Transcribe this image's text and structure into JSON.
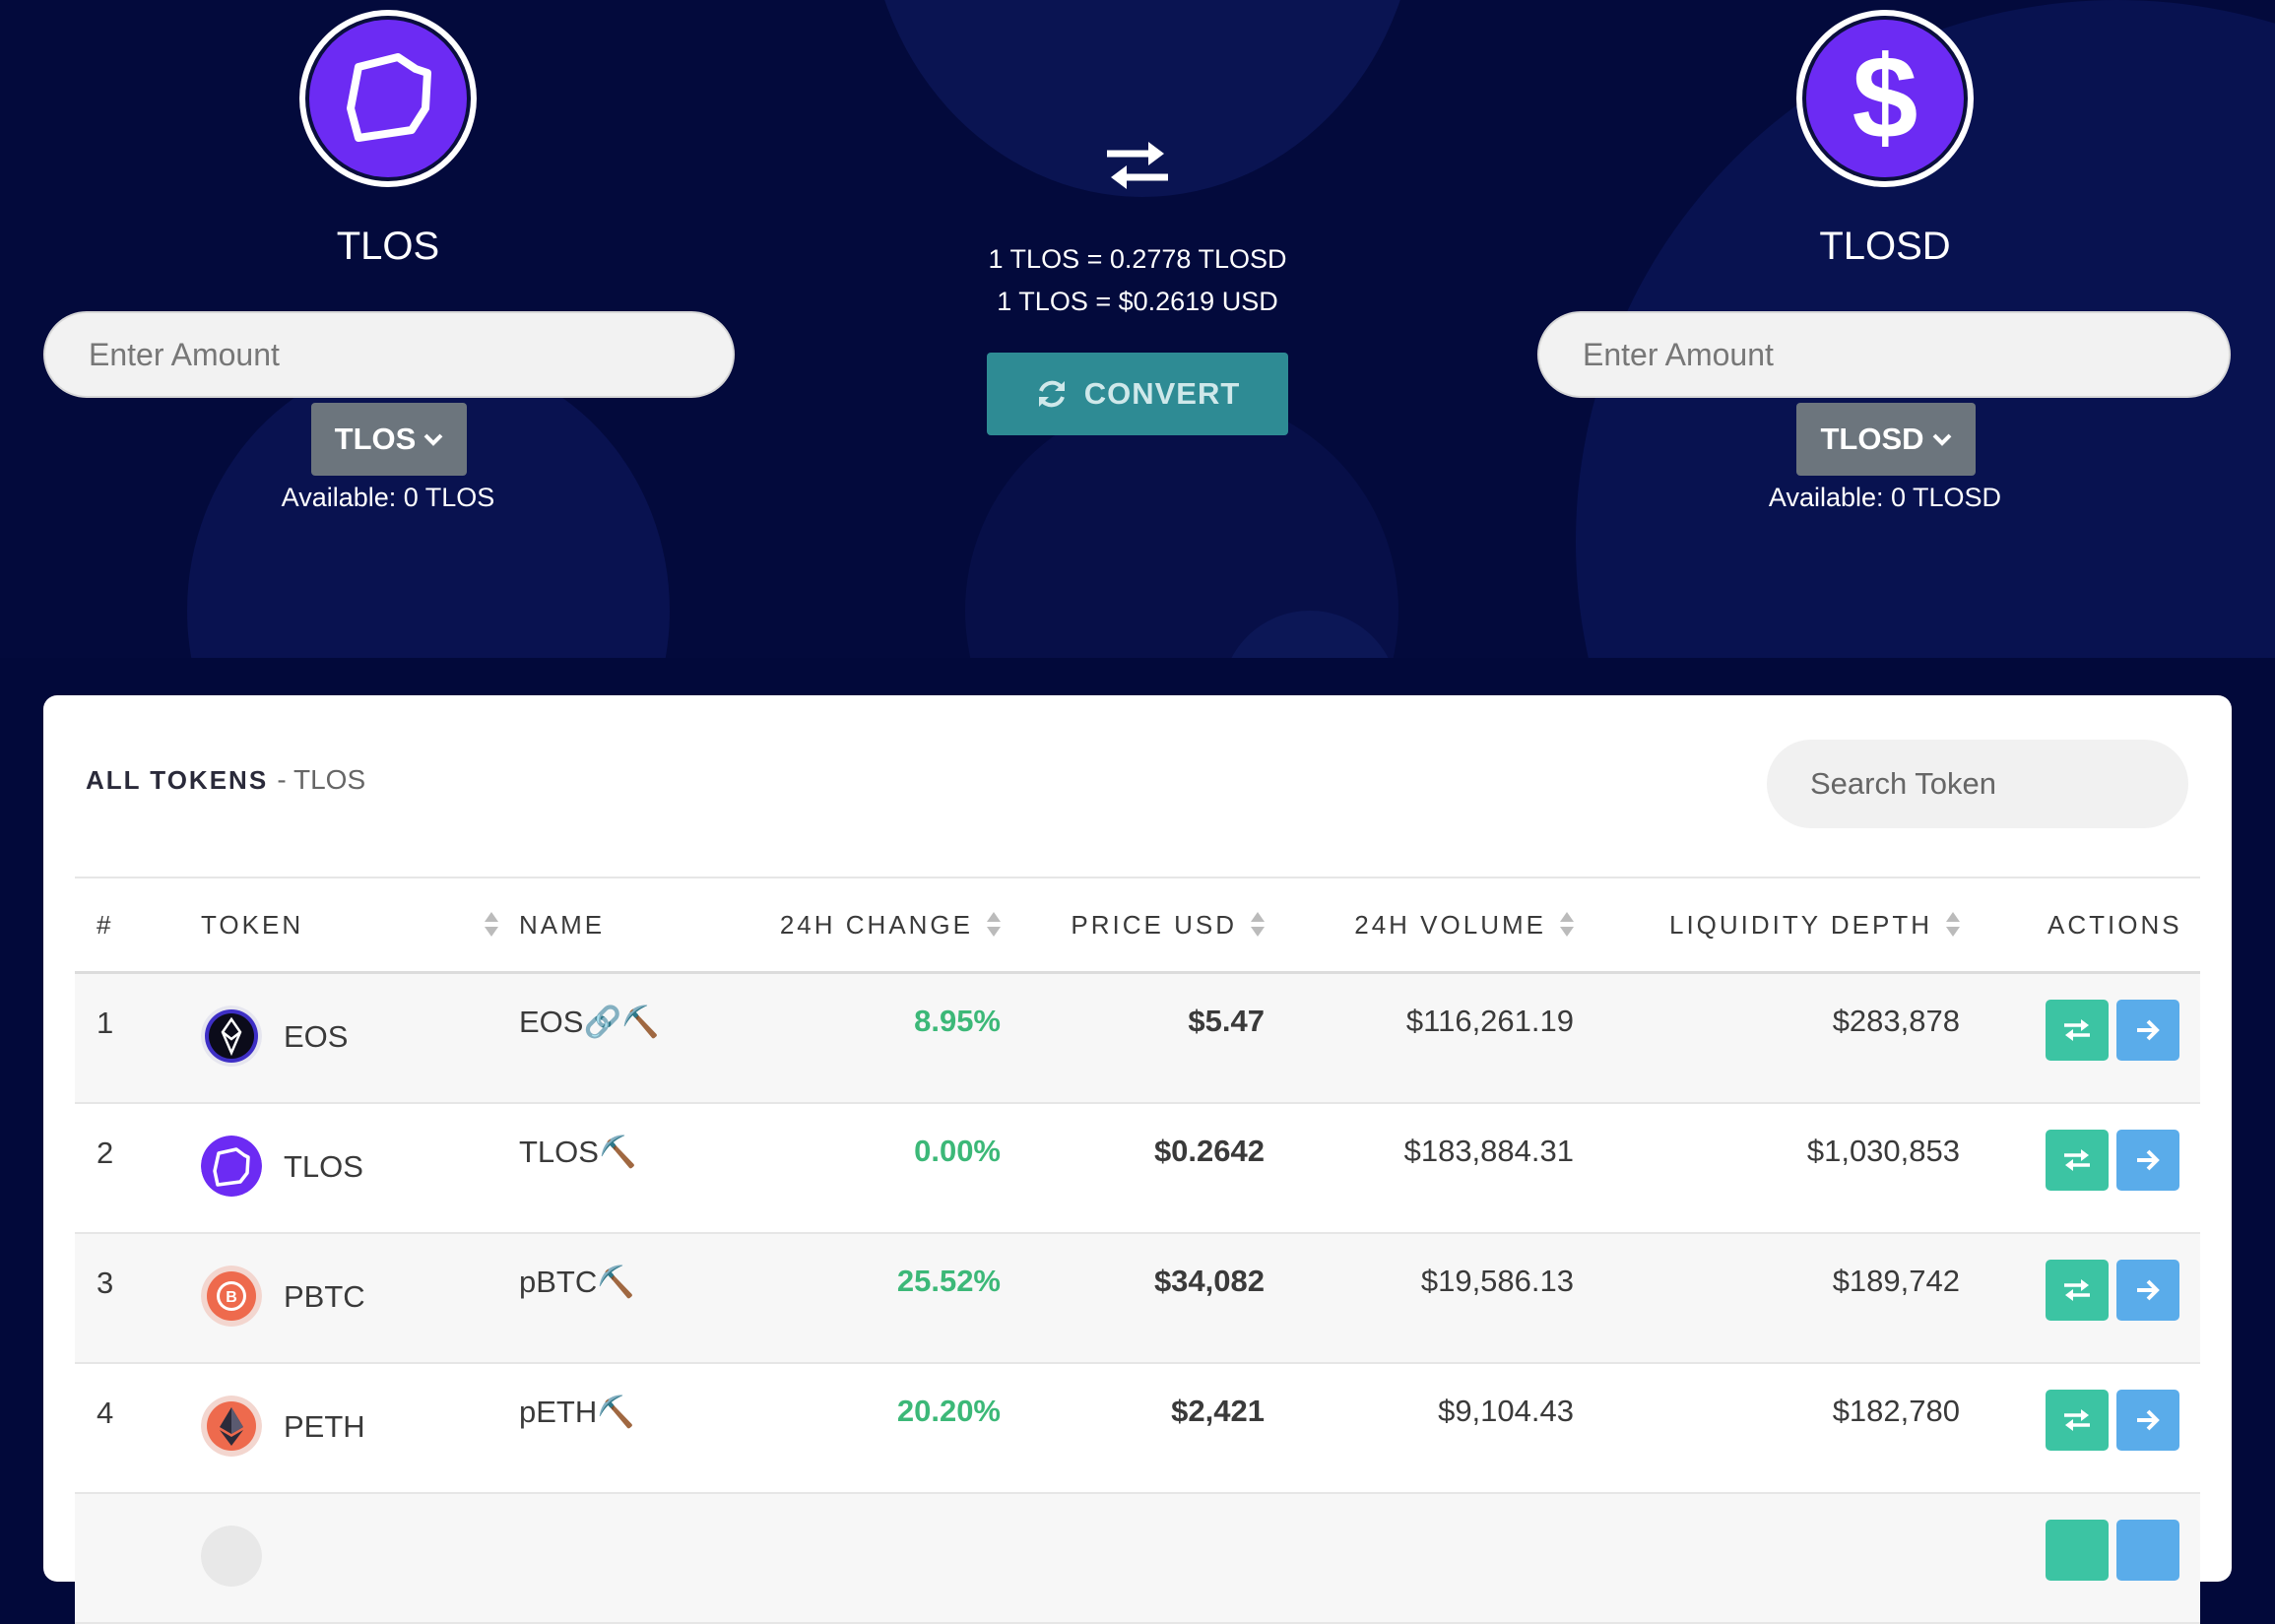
{
  "converter": {
    "from": {
      "symbol": "TLOS",
      "placeholder": "Enter Amount",
      "selector": "TLOS",
      "available": "Available: 0 TLOS",
      "icon": "telos-icon"
    },
    "to": {
      "symbol": "TLOSD",
      "placeholder": "Enter Amount",
      "selector": "TLOSD",
      "available": "Available: 0 TLOSD",
      "icon": "dollar-icon"
    },
    "rate_token": "1 TLOS = 0.2778 TLOSD",
    "rate_usd": "1 TLOS = $0.2619 USD",
    "convert_label": "CONVERT"
  },
  "tokens": {
    "title": "ALL TOKENS",
    "subtitle": "- TLOS",
    "search_placeholder": "Search Token",
    "columns": [
      "#",
      "TOKEN",
      "NAME",
      "24H CHANGE",
      "PRICE USD",
      "24H VOLUME",
      "LIQUIDITY DEPTH",
      "ACTIONS"
    ],
    "rows": [
      {
        "num": "1",
        "token": "EOS",
        "name": "EOS🔗⛏️",
        "change": "8.95%",
        "price": "$5.47",
        "volume": "$116,261.19",
        "liquidity": "$283,878",
        "icon": "eos-icon"
      },
      {
        "num": "2",
        "token": "TLOS",
        "name": "TLOS⛏️",
        "change": "0.00%",
        "price": "$0.2642",
        "volume": "$183,884.31",
        "liquidity": "$1,030,853",
        "icon": "telos-icon"
      },
      {
        "num": "3",
        "token": "PBTC",
        "name": "pBTC⛏️",
        "change": "25.52%",
        "price": "$34,082",
        "volume": "$19,586.13",
        "liquidity": "$189,742",
        "icon": "pbtc-icon"
      },
      {
        "num": "4",
        "token": "PETH",
        "name": "pETH⛏️",
        "change": "20.20%",
        "price": "$2,421",
        "volume": "$9,104.43",
        "liquidity": "$182,780",
        "icon": "peth-icon"
      }
    ]
  },
  "colors": {
    "background": "#030a3c",
    "accent": "#6c2bf3",
    "positive": "#3cb878",
    "convert": "#2e8b94",
    "swap_action": "#3cc4a3",
    "go_action": "#5aacea"
  }
}
